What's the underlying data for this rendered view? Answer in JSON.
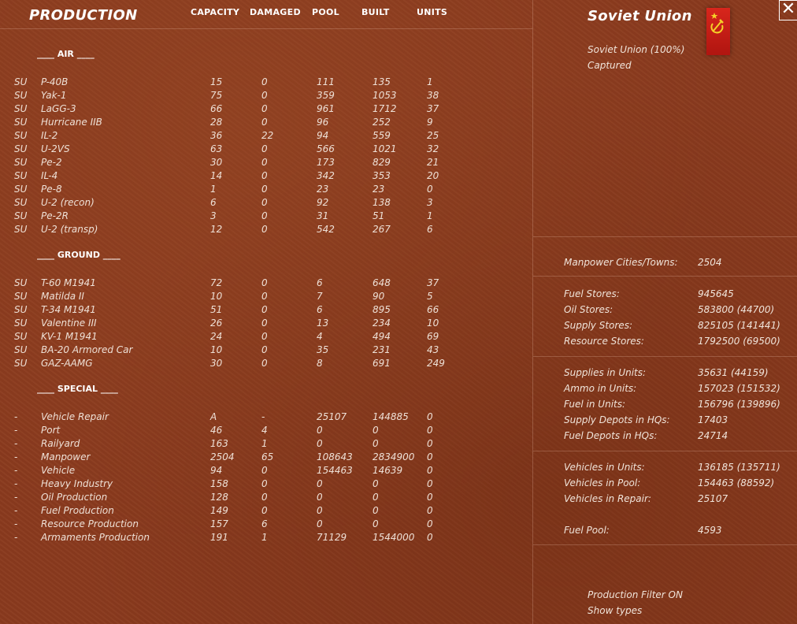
{
  "header": {
    "title": "PRODUCTION",
    "columns": [
      "CAPACITY",
      "DAMAGED",
      "POOL",
      "BUILT",
      "UNITS"
    ]
  },
  "sections": {
    "air": "____  AIR  ____",
    "ground": "____ GROUND ____",
    "special": "____ SPECIAL ____"
  },
  "air_rows": [
    [
      "SU",
      "P-40B",
      "15",
      "0",
      "111",
      "135",
      "1"
    ],
    [
      "SU",
      "Yak-1",
      "75",
      "0",
      "359",
      "1053",
      "38"
    ],
    [
      "SU",
      "LaGG-3",
      "66",
      "0",
      "961",
      "1712",
      "37"
    ],
    [
      "SU",
      "Hurricane IIB",
      "28",
      "0",
      "96",
      "252",
      "9"
    ],
    [
      "SU",
      "IL-2",
      "36",
      "22",
      "94",
      "559",
      "25"
    ],
    [
      "SU",
      "U-2VS",
      "63",
      "0",
      "566",
      "1021",
      "32"
    ],
    [
      "SU",
      "Pe-2",
      "30",
      "0",
      "173",
      "829",
      "21"
    ],
    [
      "SU",
      "IL-4",
      "14",
      "0",
      "342",
      "353",
      "20"
    ],
    [
      "SU",
      "Pe-8",
      "1",
      "0",
      "23",
      "23",
      "0"
    ],
    [
      "SU",
      "U-2 (recon)",
      "6",
      "0",
      "92",
      "138",
      "3"
    ],
    [
      "SU",
      "Pe-2R",
      "3",
      "0",
      "31",
      "51",
      "1"
    ],
    [
      "SU",
      "U-2 (transp)",
      "12",
      "0",
      "542",
      "267",
      "6"
    ]
  ],
  "ground_rows": [
    [
      "SU",
      "T-60 M1941",
      "72",
      "0",
      "6",
      "648",
      "37"
    ],
    [
      "SU",
      "Matilda II",
      "10",
      "0",
      "7",
      "90",
      "5"
    ],
    [
      "SU",
      "T-34 M1941",
      "51",
      "0",
      "6",
      "895",
      "66"
    ],
    [
      "SU",
      "Valentine III",
      "26",
      "0",
      "13",
      "234",
      "10"
    ],
    [
      "SU",
      "KV-1 M1941",
      "24",
      "0",
      "4",
      "494",
      "69"
    ],
    [
      "SU",
      "BA-20 Armored Car",
      "10",
      "0",
      "35",
      "231",
      "43"
    ],
    [
      "SU",
      "GAZ-AAMG",
      "30",
      "0",
      "8",
      "691",
      "249"
    ]
  ],
  "special_rows": [
    [
      "-",
      "Vehicle Repair",
      "A",
      "-",
      "25107",
      "144885",
      "0"
    ],
    [
      "-",
      "Port",
      "46",
      "4",
      "0",
      "0",
      "0"
    ],
    [
      "-",
      "Railyard",
      "163",
      "1",
      "0",
      "0",
      "0"
    ],
    [
      "-",
      "Manpower",
      "2504",
      "65",
      "108643",
      "2834900",
      "0"
    ],
    [
      "-",
      "Vehicle",
      "94",
      "0",
      "154463",
      "14639",
      "0"
    ],
    [
      "-",
      "Heavy Industry",
      "158",
      "0",
      "0",
      "0",
      "0"
    ],
    [
      "-",
      "Oil Production",
      "128",
      "0",
      "0",
      "0",
      "0"
    ],
    [
      "-",
      "Fuel Production",
      "149",
      "0",
      "0",
      "0",
      "0"
    ],
    [
      "-",
      "Resource Production",
      "157",
      "6",
      "0",
      "0",
      "0"
    ],
    [
      "-",
      "Armaments Production",
      "191",
      "1",
      "71129",
      "1544000",
      "0"
    ]
  ],
  "nation": {
    "name": "Soviet Union",
    "control": "Soviet Union  (100%)",
    "status": "Captured",
    "flag_color": "#c8201a",
    "emblem": "hammer-sickle-icon"
  },
  "stats": {
    "group1": [
      [
        "Manpower Cities/Towns:",
        "2504"
      ]
    ],
    "group2": [
      [
        "Fuel Stores:",
        "945645"
      ],
      [
        "Oil Stores:",
        "583800 (44700)"
      ],
      [
        "Supply Stores:",
        "825105 (141441)"
      ],
      [
        "Resource Stores:",
        "1792500 (69500)"
      ]
    ],
    "group3": [
      [
        "Supplies in Units:",
        "35631 (44159)"
      ],
      [
        "Ammo in Units:",
        "157023 (151532)"
      ],
      [
        "Fuel in Units:",
        "156796 (139896)"
      ],
      [
        "Supply Depots in HQs:",
        "17403"
      ],
      [
        "Fuel Depots in HQs:",
        "24714"
      ]
    ],
    "group4": [
      [
        "Vehicles in Units:",
        "136185 (135711)"
      ],
      [
        "Vehicles in Pool:",
        "154463 (88592)"
      ],
      [
        "Vehicles in Repair:",
        "25107"
      ],
      [
        "Fuel Pool:",
        "4593"
      ]
    ]
  },
  "footer": {
    "filter": "Production Filter ON",
    "show_types": "Show types"
  },
  "close_label": "✕"
}
